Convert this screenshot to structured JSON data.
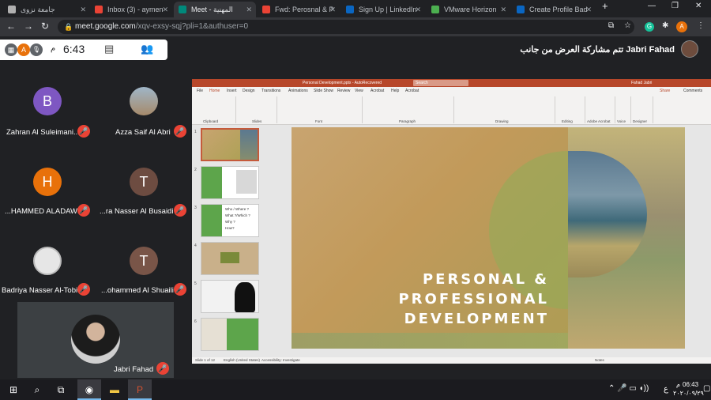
{
  "browser": {
    "tabs": [
      {
        "label": "جامعة نزوى",
        "favicon_color": "#b0b0b0"
      },
      {
        "label": "Inbox (3) - aymen",
        "favicon_color": "#ea4335"
      },
      {
        "label": "Meet - المهنية",
        "favicon_color": "#00897b"
      },
      {
        "label": "Fwd: Perosnal & P",
        "favicon_color": "#ea4335"
      },
      {
        "label": "Sign Up | LinkedIn",
        "favicon_color": "#0a66c2"
      },
      {
        "label": "VMware Horizon",
        "favicon_color": "#4caf50"
      },
      {
        "label": "Create Profile Bad",
        "favicon_color": "#0a66c2"
      }
    ],
    "new_tab": "+",
    "url_host": "meet.google.com",
    "url_path": "/xqv-exsy-sqj?pli=1&authuser=0",
    "profile_initial": "A"
  },
  "meet": {
    "clock": "6:43",
    "clock_suffix": "م",
    "user_initial": "A",
    "presenter_text": "تتم مشاركة العرض من جانب Jabri Fahad",
    "participants": [
      {
        "name": "Zahran Al Suleimani...",
        "initial": "B",
        "color": "#7e57c2"
      },
      {
        "name": "Azza Saif Al Abri",
        "initial": "",
        "color": "#8d9aa5"
      },
      {
        "name": "...HAMMED ALADAWI",
        "initial": "H",
        "color": "#e8710a"
      },
      {
        "name": "...ra Nasser Al Busaidi",
        "initial": "T",
        "color": "#6d4c41"
      },
      {
        "name": "Badriya Nasser Al-Tobi",
        "initial": "",
        "color": "#d7d7d7"
      },
      {
        "name": "...ohammed Al Shuaili",
        "initial": "T",
        "color": "#795548"
      },
      {
        "name": "Jabri Fahad",
        "initial": "",
        "color": "#6d4c3d"
      }
    ]
  },
  "powerpoint": {
    "title": "Personal Development.pptx - AutoRecovered",
    "search": "Search",
    "user": "Fahad Jabri",
    "ribbon_tabs": [
      "File",
      "Home",
      "Insert",
      "Design",
      "Transitions",
      "Animations",
      "Slide Show",
      "Review",
      "View",
      "Acrobat",
      "Help",
      "Acrobat"
    ],
    "share": "Share",
    "comments": "Comments",
    "groups": [
      "Clipboard",
      "Slides",
      "Font",
      "Paragraph",
      "Drawing",
      "Editing",
      "Adobe Acrobat",
      "Voice",
      "Designer"
    ],
    "slide_numbers": [
      "1",
      "2",
      "3",
      "4",
      "5",
      "6"
    ],
    "thumb3_items": [
      "Who / Where ?",
      "What ?/Which ?",
      "Why ?",
      "How?"
    ],
    "slide_title_lines": [
      "PERSONAL &",
      "PROFESSIONAL",
      "DEVELOPMENT"
    ],
    "status_left": "Slide 1 of 12",
    "status_lang": "English (United States)",
    "status_access": "Accessibility: Investigate",
    "status_notes": "Notes",
    "accent": "#b7472a"
  },
  "taskbar": {
    "time": "06:43",
    "time_suffix": "م",
    "date": "٢٠٢٠/٠٩/٢٩",
    "lang": "ع"
  }
}
